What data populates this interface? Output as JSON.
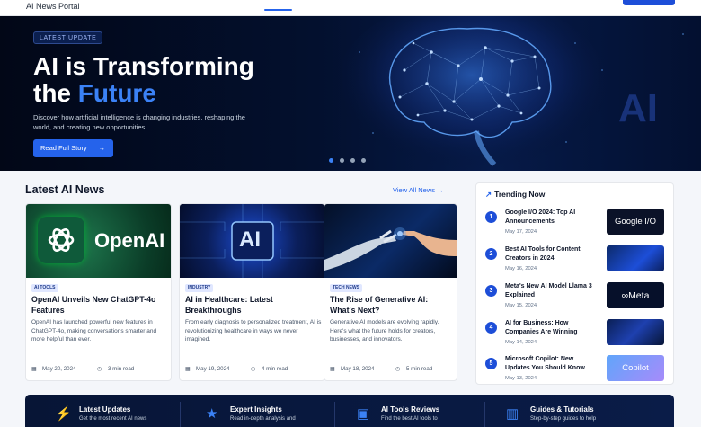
{
  "header": {
    "brand": "AI News Portal"
  },
  "hero": {
    "tag": "LATEST UPDATE",
    "title_line1": "AI is Transforming",
    "title_line2_a": "the ",
    "title_line2_b": "Future",
    "description": "Discover how artificial intelligence is changing industries, reshaping the world, and creating new opportunities.",
    "button": "Read Full Story",
    "art_text": "AI",
    "slides": 4,
    "active_slide": 1
  },
  "latest": {
    "title": "Latest AI News",
    "view_all": "View All News",
    "cards": [
      {
        "image_text": "OpenAI",
        "tag": "AI TOOLS",
        "title": "OpenAI Unveils New ChatGPT-4o Features",
        "desc": "OpenAI has launched powerful new features in ChatGPT-4o, making conversations smarter and more helpful than ever.",
        "date": "May 20, 2024",
        "read": "3 min read"
      },
      {
        "image_text": "AI",
        "tag": "INDUSTRY",
        "title": "AI in Healthcare: Latest Breakthroughs",
        "desc": "From early diagnosis to personalized treatment, AI is revolutionizing healthcare in ways we never imagined.",
        "date": "May 19, 2024",
        "read": "4 min read"
      },
      {
        "image_text": "",
        "tag": "TECH NEWS",
        "title": "The Rise of Generative AI: What's Next?",
        "desc": "Generative AI models are evolving rapidly. Here's what the future holds for creators, businesses, and innovators.",
        "date": "May 18, 2024",
        "read": "5 min read"
      }
    ]
  },
  "trending": {
    "title": "Trending Now",
    "items": [
      {
        "num": "1",
        "title": "Google I/O 2024: Top AI Announcements",
        "date": "May 17, 2024",
        "thumb": "Google I/O"
      },
      {
        "num": "2",
        "title": "Best AI Tools for Content Creators in 2024",
        "date": "May 16, 2024",
        "thumb": ""
      },
      {
        "num": "3",
        "title": "Meta's New AI Model Llama 3 Explained",
        "date": "May 15, 2024",
        "thumb": "∞Meta"
      },
      {
        "num": "4",
        "title": "AI for Business: How Companies Are Winning",
        "date": "May 14, 2024",
        "thumb": ""
      },
      {
        "num": "5",
        "title": "Microsoft Copilot: New Updates You Should Know",
        "date": "May 13, 2024",
        "thumb": "Copilot"
      }
    ]
  },
  "features": [
    {
      "icon": "lightning-icon",
      "title": "Latest Updates",
      "desc": "Get the most recent AI news"
    },
    {
      "icon": "expert-icon",
      "title": "Expert Insights",
      "desc": "Read in-depth analysis and"
    },
    {
      "icon": "toolbox-icon",
      "title": "AI Tools Reviews",
      "desc": "Find the best AI tools to"
    },
    {
      "icon": "book-icon",
      "title": "Guides & Tutorials",
      "desc": "Step-by-step guides to help"
    }
  ],
  "colors": {
    "accent": "#2563eb",
    "hero_bg": "#03102e",
    "feature_bg": "#0a1c48"
  }
}
